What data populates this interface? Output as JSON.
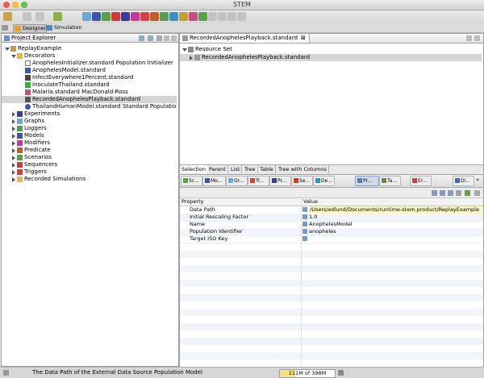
{
  "window": {
    "title": "STEM"
  },
  "perspectives": {
    "designer": "Designer",
    "simulation": "Simulation"
  },
  "project_explorer": {
    "tab_title": "Project Explorer",
    "root": "ReplayExample",
    "decorators_folder": "Decorators",
    "decorators": [
      "AnophelesInitializer.standard Population Initializer",
      "AnophelesModel.standard",
      "InfectEverywhere1Percent.standard",
      "InoculateThailand.standard",
      "Malaria.standard MacDonald-Ross",
      "RecordedAnophelesPlayback.standard",
      "ThailandHumanModel.standard Standard Population M"
    ],
    "folders": [
      "Experiments",
      "Graphs",
      "Loggers",
      "Models",
      "Modifiers",
      "Predicate",
      "Scenarios",
      "Sequencers",
      "Triggers",
      "Recorded Simulations"
    ]
  },
  "editor": {
    "tab_title": "RecordedAnophelesPlayback.standard",
    "resource_set": "Resource Set",
    "resource_item": "RecordedAnophelesPlayback.standard",
    "bottom_tabs": [
      "Selection",
      "Parent",
      "List",
      "Tree",
      "Table",
      "Tree with Columns"
    ]
  },
  "views_bar": {
    "tabs": [
      "Sc...",
      "Mo...",
      "Gr...",
      "Tr...",
      "Pr...",
      "Se...",
      "De...",
      "Pr...",
      "Ta...",
      "Er...",
      "Di..."
    ]
  },
  "properties": {
    "col_property": "Property",
    "col_value": "Value",
    "rows": [
      {
        "name": "Data Path",
        "value": "/Users/edlund/Documents/runtime-stem.product/ReplayExample"
      },
      {
        "name": "Initial Rescaling Factor",
        "value": "1.0"
      },
      {
        "name": "Name",
        "value": "AnophelesModel"
      },
      {
        "name": "Population Identifier",
        "value": "anopheles"
      },
      {
        "name": "Target ISO Key",
        "value": ""
      }
    ]
  },
  "status_bar": {
    "message": "The Data Path of the External Data Source Population Model",
    "memory": "111M of 398M"
  },
  "colors": {
    "folder": "#e8b84a",
    "selection": "#d5d5d5",
    "memory_bar": "#f5e27a"
  }
}
